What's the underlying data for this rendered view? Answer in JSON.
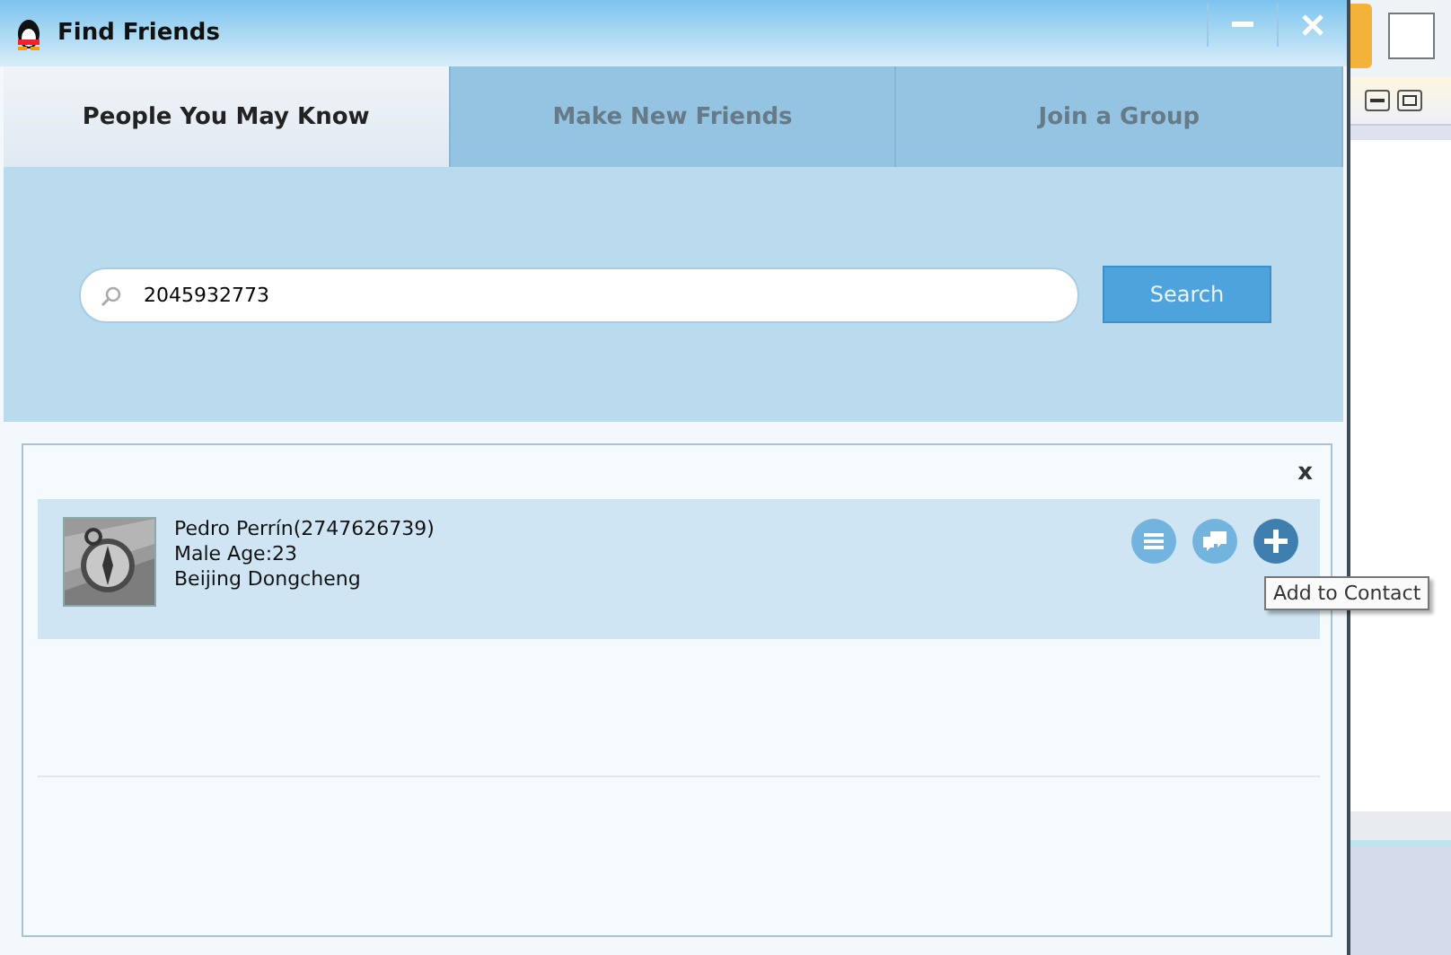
{
  "window": {
    "title": "Find Friends"
  },
  "tabs": [
    {
      "label": "People You May Know",
      "selected": true
    },
    {
      "label": "Make New Friends",
      "selected": false
    },
    {
      "label": "Join a Group",
      "selected": false
    }
  ],
  "search": {
    "value": "2045932773",
    "button": "Search"
  },
  "results": [
    {
      "name": "Pedro Perrín(2747626739)",
      "details": "Male  Age:23",
      "location": "Beijing Dongcheng"
    }
  ],
  "close_symbol": "x",
  "tooltip": "Add to Contact"
}
